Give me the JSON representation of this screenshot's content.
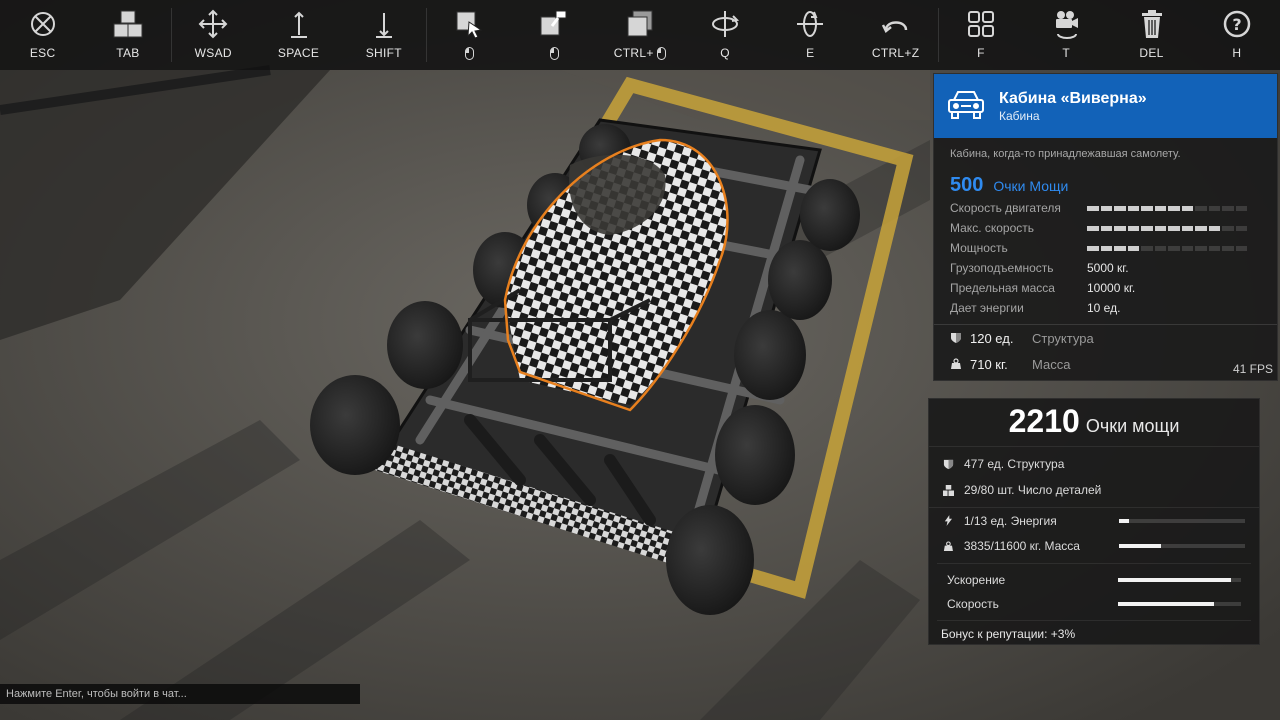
{
  "toolbar": {
    "buttons": [
      {
        "icon": "cancel-exit-icon",
        "key": "ESC"
      },
      {
        "icon": "parts-crate-icon",
        "key": "TAB"
      },
      {
        "icon": "move-arrows-icon",
        "key": "WSAD"
      },
      {
        "icon": "arrow-up-icon",
        "key": "SPACE"
      },
      {
        "icon": "arrow-down-icon",
        "key": "SHIFT"
      },
      {
        "icon": "select-part-icon",
        "key": ""
      },
      {
        "icon": "paint-part-icon",
        "key": ""
      },
      {
        "icon": "copy-part-icon",
        "key": "CTRL+"
      },
      {
        "icon": "rotate-vertical-icon",
        "key": "Q"
      },
      {
        "icon": "rotate-horizontal-icon",
        "key": "E"
      },
      {
        "icon": "undo-icon",
        "key": "CTRL+Z"
      },
      {
        "icon": "grid-view-icon",
        "key": "F"
      },
      {
        "icon": "camera-rotate-icon",
        "key": "T"
      },
      {
        "icon": "trash-icon",
        "key": "DEL"
      },
      {
        "icon": "help-icon",
        "key": "H"
      }
    ]
  },
  "part": {
    "title": "Кабина «Виверна»",
    "subtitle": "Кабина",
    "description": "Кабина, когда-то принадлежавшая самолету.",
    "power_value": "500",
    "power_label": "Очки Мощи",
    "bar_stats": [
      {
        "label": "Скорость двигателя",
        "level": 0.7
      },
      {
        "label": "Макс. скорость",
        "level": 0.8
      },
      {
        "label": "Мощность",
        "level": 0.35
      }
    ],
    "text_stats": [
      {
        "label": "Грузоподъемность",
        "value": "5000 кг."
      },
      {
        "label": "Предельная масса",
        "value": "10000 кг."
      },
      {
        "label": "Дает энергии",
        "value": "10 ед."
      }
    ],
    "structure": {
      "value": "120 ед.",
      "label": "Структура"
    },
    "mass": {
      "value": "710 кг.",
      "label": "Масса"
    },
    "fps": "41 FPS"
  },
  "summary": {
    "power_value": "2210",
    "power_label": "Очки мощи",
    "structure": "477 ед. Структура",
    "parts_count": "29/80 шт. Число деталей",
    "energy": {
      "text": "1/13 ед. Энергия",
      "level": 0.077
    },
    "mass": {
      "text": "3835/11600 кг. Масса",
      "level": 0.33
    },
    "acceleration": {
      "label": "Ускорение",
      "level": 0.92
    },
    "speed": {
      "label": "Скорость",
      "level": 0.78
    },
    "reputation_bonus": "Бонус к репутации: +3%"
  },
  "chat": {
    "placeholder": "Нажмите Enter, чтобы войти в чат..."
  },
  "colors": {
    "accent_blue": "#1262b8",
    "power_blue": "#2f8bf0",
    "floor_marking_yellow": "#c8a33a",
    "selection_outline_orange": "#e8801e"
  }
}
